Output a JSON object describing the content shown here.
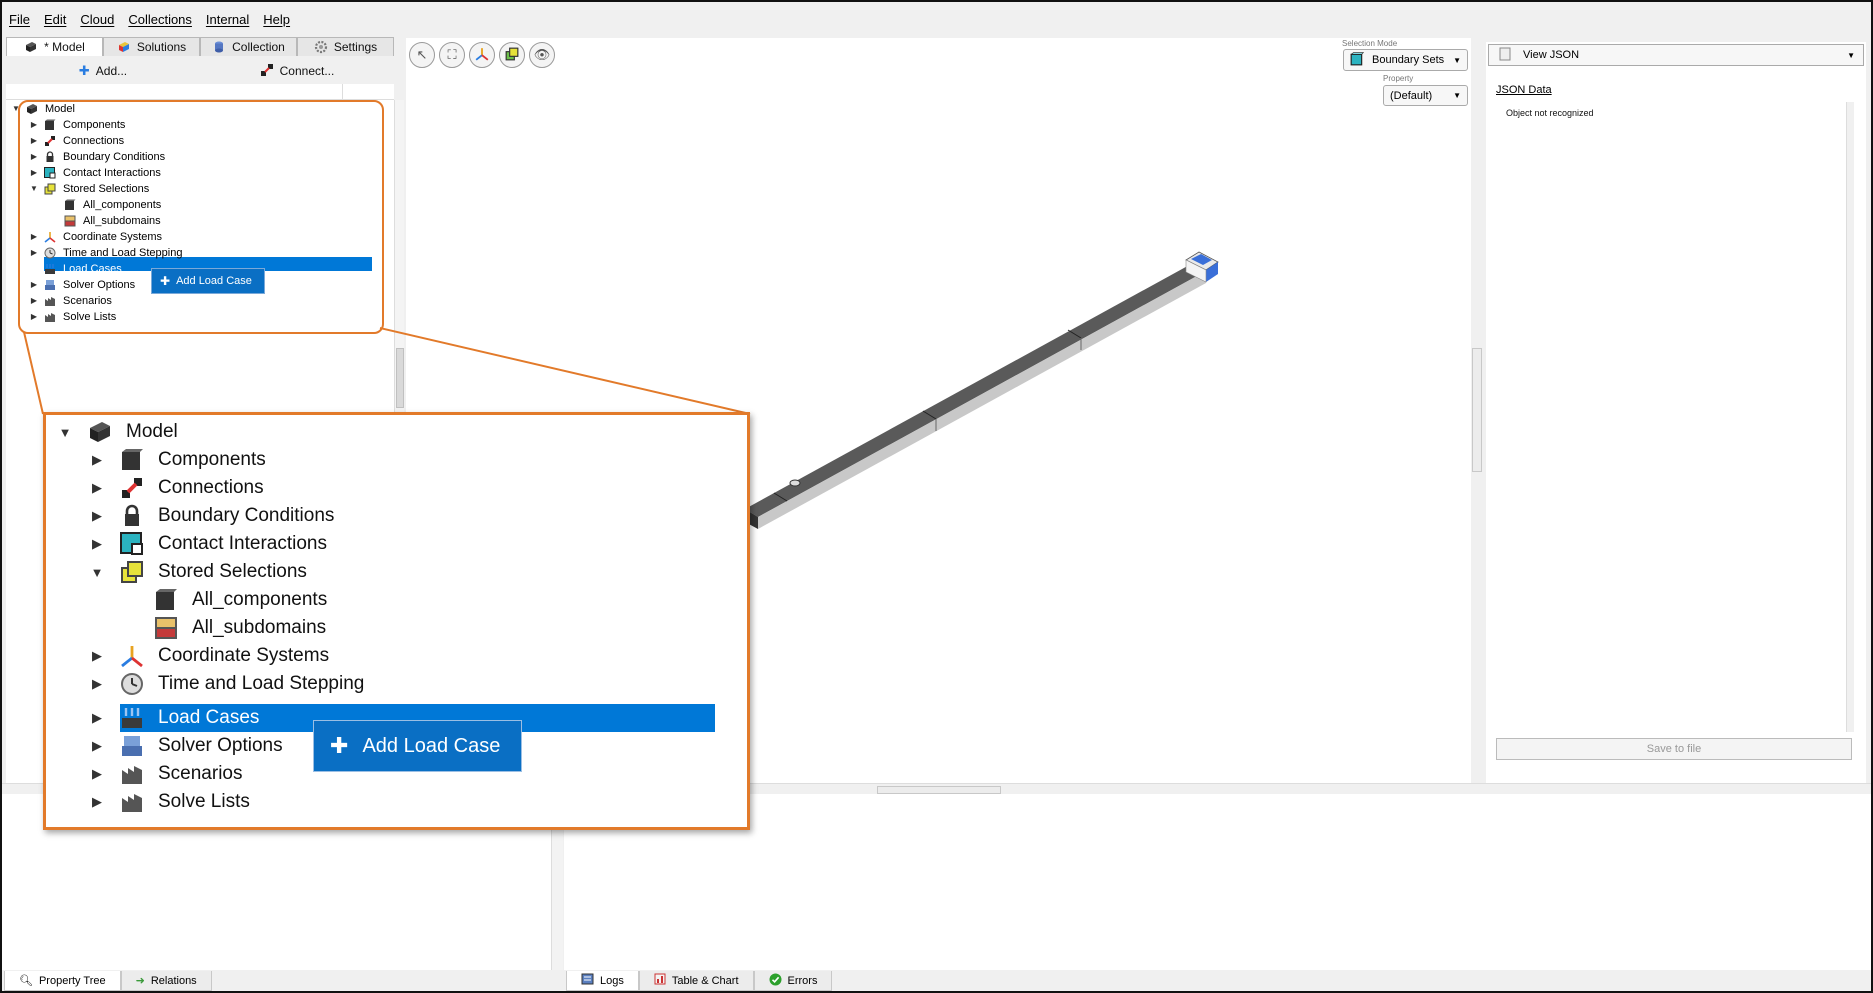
{
  "menu": [
    "File",
    "Edit",
    "Cloud",
    "Collections",
    "Internal",
    "Help"
  ],
  "tabs": [
    {
      "label": "* Model"
    },
    {
      "label": "Solutions"
    },
    {
      "label": "Collection"
    },
    {
      "label": "Settings"
    }
  ],
  "actions": {
    "add": "Add...",
    "connect": "Connect..."
  },
  "tree": {
    "root": "Model",
    "items": [
      "Components",
      "Connections",
      "Boundary Conditions",
      "Contact Interactions",
      "Stored Selections",
      "All_components",
      "All_subdomains",
      "Coordinate Systems",
      "Time and Load Stepping",
      "Load Cases",
      "Solver Options",
      "Scenarios",
      "Solve Lists"
    ]
  },
  "context_menu": {
    "add_load_case": "Add Load Case"
  },
  "viewport": {
    "selection_mode_label": "Selection Mode",
    "selection_mode_value": "Boundary Sets",
    "property_label": "Property",
    "property_value": "(Default)"
  },
  "right_panel": {
    "view": "View JSON",
    "json_label": "JSON Data",
    "message": "Object not recognized",
    "save": "Save to file"
  },
  "bottom_tabs_left": [
    "Property Tree",
    "Relations"
  ],
  "bottom_tabs_right": [
    "Logs",
    "Table & Chart",
    "Errors"
  ],
  "colors": {
    "accent": "#0078d7",
    "callout": "#e27a2a",
    "selection": "#0078d7"
  }
}
